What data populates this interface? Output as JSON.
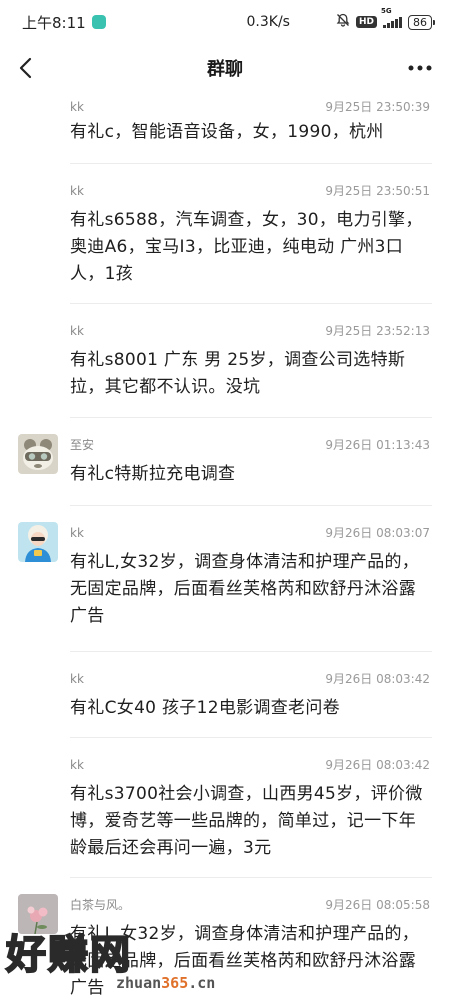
{
  "status_bar": {
    "time": "上午8:11",
    "net_speed": "0.3K/s",
    "hd": "HD",
    "network": "5G",
    "battery": "86"
  },
  "header": {
    "title": "群聊",
    "more": "•••"
  },
  "messages": [
    {
      "sender": "kk",
      "time": "9月25日 23:50:39",
      "text": "有礼c，智能语音设备，女，1990，杭州"
    },
    {
      "sender": "kk",
      "time": "9月25日 23:50:51",
      "text": "有礼s6588，汽车调查，女，30，电力引擎，奥迪A6，宝马I3，比亚迪，纯电动 广州3口人，1孩"
    },
    {
      "sender": "kk",
      "time": "9月25日 23:52:13",
      "text": "有礼s8001 广东 男 25岁，调查公司选特斯拉，其它都不认识。没坑"
    },
    {
      "sender": "至安",
      "time": "9月26日 01:13:43",
      "text": "有礼c特斯拉充电调查"
    },
    {
      "sender": "kk",
      "time": "9月26日 08:03:07",
      "text": "有礼L,女32岁，调查身体清洁和护理产品的，无固定品牌，后面看丝芙格芮和欧舒丹沐浴露广告"
    },
    {
      "sender": "kk",
      "time": "9月26日 08:03:42",
      "text": "有礼C女40 孩子12电影调查老问卷"
    },
    {
      "sender": "kk",
      "time": "9月26日 08:03:42",
      "text": "有礼s3700社会小调查，山西男45岁，评价微博，爱奇艺等一些品牌的，简单过，记一下年龄最后还会再问一遍，3元"
    },
    {
      "sender": "白茶与风。",
      "time": "9月26日 08:05:58",
      "text": "有礼L,女32岁，调查身体清洁和护理产品的，无固定品牌，后面看丝芙格芮和欧舒丹沐浴露广告"
    }
  ],
  "watermark": {
    "main": "好赚网",
    "sub_prefix": "zhuan",
    "sub_highlight": "365",
    "sub_suffix": ".cn"
  }
}
